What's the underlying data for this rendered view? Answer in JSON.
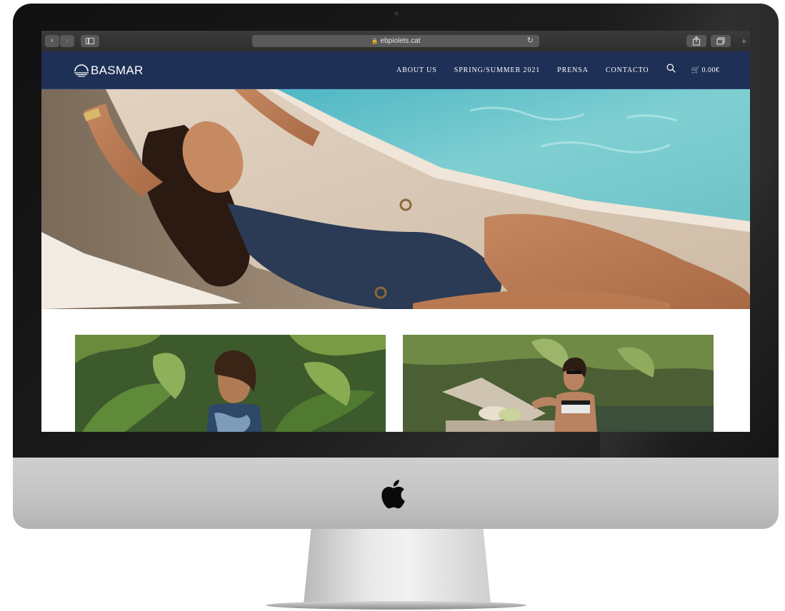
{
  "browser": {
    "url": "ebpiolets.cat",
    "back_icon": "chevron-left-icon",
    "forward_icon": "chevron-right-icon",
    "sidebar_icon": "sidebar-icon",
    "reload_icon": "reload-icon",
    "share_icon": "share-icon",
    "tabs_icon": "tabs-icon",
    "new_tab_icon": "plus-icon"
  },
  "site": {
    "logo_text": "BASMAR",
    "nav": [
      {
        "label": "ABOUT US"
      },
      {
        "label": "SPRING/SUMMER 2021"
      },
      {
        "label": "PRENSA"
      },
      {
        "label": "CONTACTO"
      }
    ],
    "search_icon": "search-icon",
    "cart": {
      "icon": "cart-icon",
      "total": "0.00€"
    }
  },
  "colors": {
    "header_bg": "#1e3056",
    "page_bg": "#ffffff",
    "bezel": "#111111",
    "chin": "#c4c4c4"
  }
}
